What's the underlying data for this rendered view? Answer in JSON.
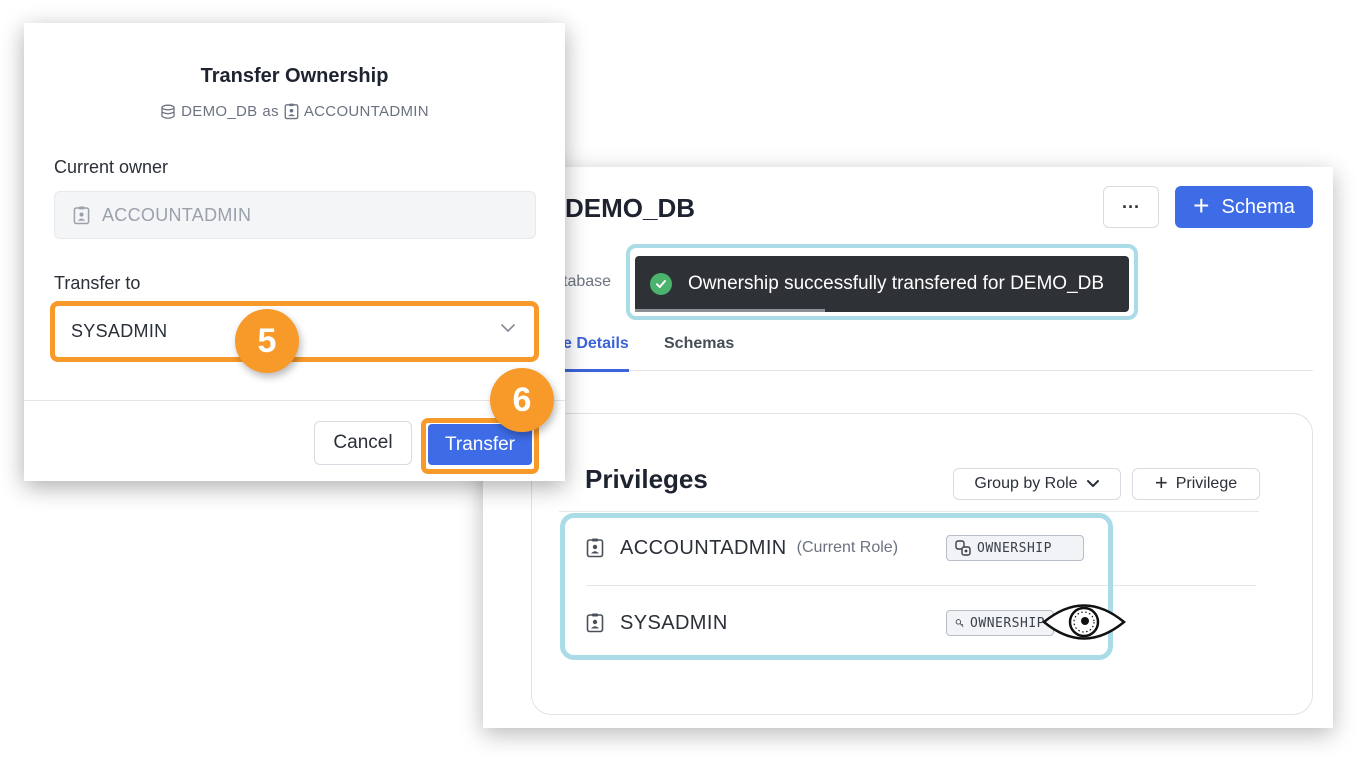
{
  "dialog": {
    "title": "Transfer Ownership",
    "subtitle_db": "DEMO_DB",
    "subtitle_as": "as",
    "subtitle_role": "ACCOUNTADMIN",
    "current_owner_label": "Current owner",
    "current_owner_value": "ACCOUNTADMIN",
    "transfer_to_label": "Transfer to",
    "transfer_to_value": "SYSADMIN",
    "cancel_label": "Cancel",
    "transfer_label": "Transfer"
  },
  "steps": {
    "step_select": "5",
    "step_transfer": "6"
  },
  "database": {
    "name": "DEMO_DB",
    "more_label": "···",
    "add_schema_plus": "+",
    "add_schema_label": "Schema",
    "breadcrumb": "tabase",
    "toast": "Ownership successfully transfered for DEMO_DB",
    "tabs": [
      {
        "label": "e Details",
        "active": true
      },
      {
        "label": "Schemas",
        "active": false
      }
    ]
  },
  "privileges": {
    "title": "Privileges",
    "group_by_label": "Group by Role",
    "add_privilege_plus": "+",
    "add_privilege_label": "Privilege",
    "rows": [
      {
        "role": "ACCOUNTADMIN",
        "note": "(Current Role)",
        "badge": "OWNERSHIP"
      },
      {
        "role": "SYSADMIN",
        "note": "",
        "badge": "OWNERSHIP"
      }
    ]
  },
  "colors": {
    "accent_blue": "#3d6ce6",
    "highlight_orange": "#f79a2a",
    "highlight_teal": "#a9dce6",
    "toast_bg": "#2e3136",
    "success_green": "#4cb36e"
  },
  "icons": [
    "database-icon",
    "role-icon",
    "chevron-down-icon",
    "check-circle-icon",
    "ownership-transfer-icon",
    "key-icon",
    "eye-icon",
    "plus-icon",
    "more-icon"
  ]
}
